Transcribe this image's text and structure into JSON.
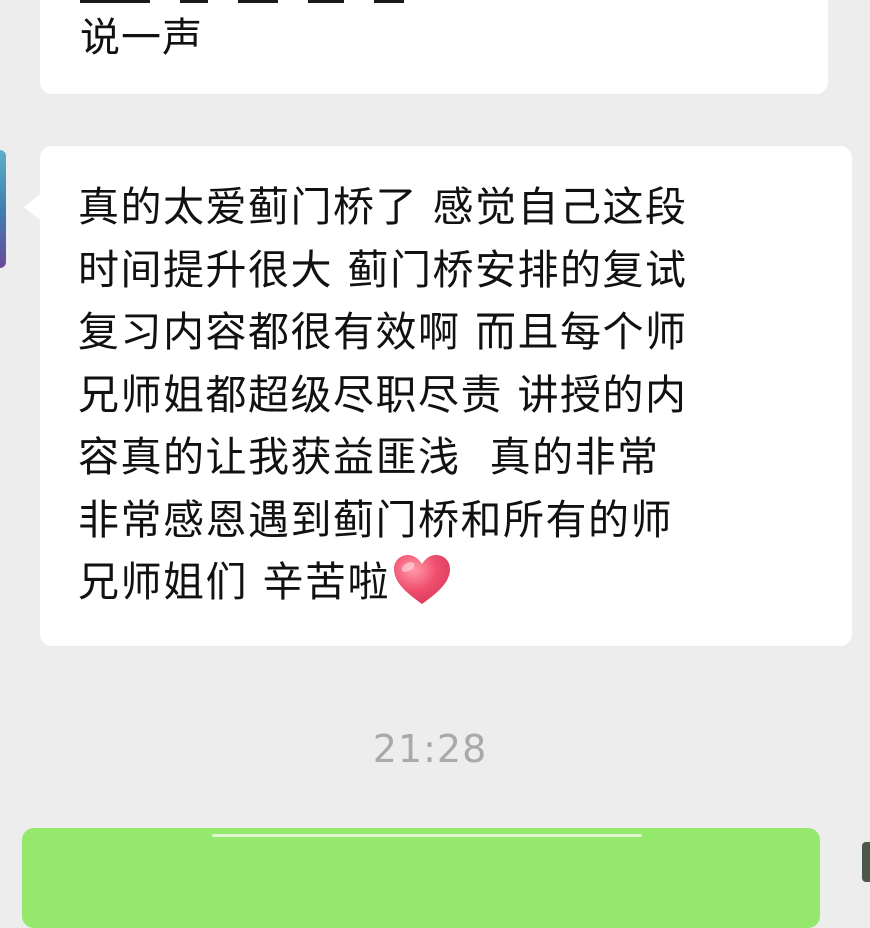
{
  "chat": {
    "messages": [
      {
        "from": "contact",
        "text": "说一声"
      },
      {
        "from": "contact",
        "lines": [
          "真的太爱蓟门桥了 感觉自己这段",
          "时间提升很大 蓟门桥安排的复试",
          "复习内容都很有效啊 而且每个师",
          "兄师姐都超级尽职尽责 讲授的内",
          "容真的让我获益匪浅  真的非常",
          "非常感恩遇到蓟门桥和所有的师",
          "兄师姐们 辛苦啦"
        ],
        "emoji": "red-heart"
      }
    ],
    "timestamp": "21:28"
  },
  "colors": {
    "background": "#ededed",
    "incoming_bubble": "#ffffff",
    "outgoing_bubble": "#94e86c",
    "timestamp_text": "#a9a9a9",
    "heart": "#f0506e"
  }
}
